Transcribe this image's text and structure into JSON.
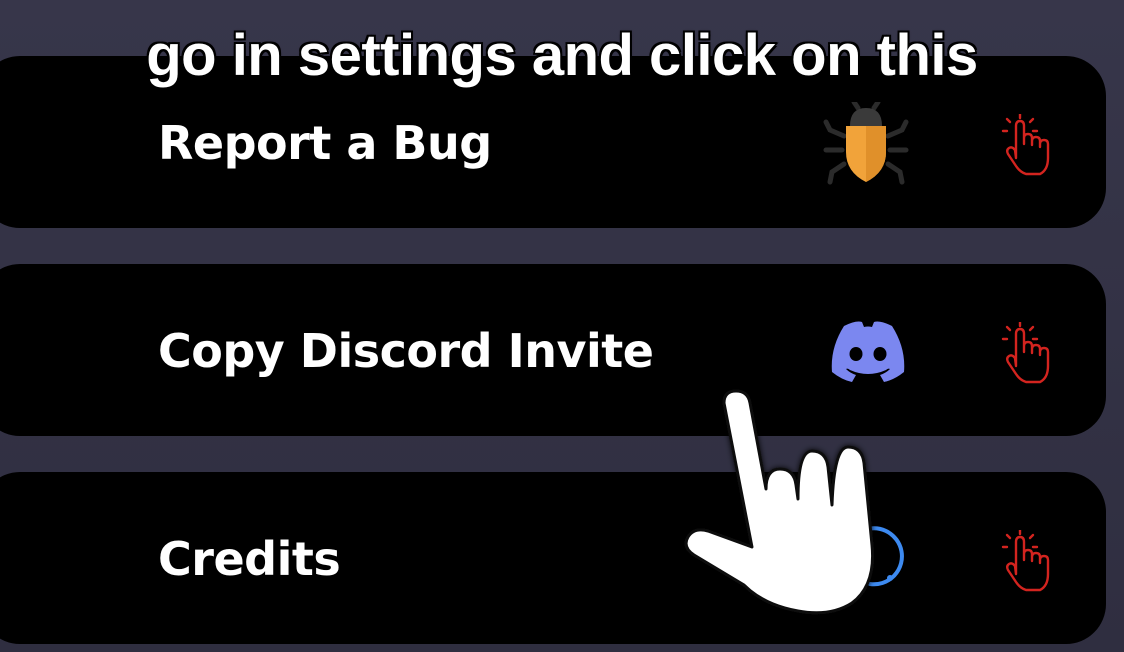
{
  "caption": "go in settings and click on this",
  "settings": {
    "items": [
      {
        "label": "Report a Bug",
        "icon": "bug-icon"
      },
      {
        "label": "Copy Discord Invite",
        "icon": "discord-icon"
      },
      {
        "label": "Credits",
        "icon": "credits-icon"
      }
    ],
    "tap_icon": "tap-hand-icon"
  },
  "colors": {
    "background": "#35344a",
    "card": "#000000",
    "text": "#ffffff",
    "bug_orange": "#f1a33a",
    "discord_blurple": "#7b87f0",
    "credits_blue": "#3d8af0",
    "tap_red": "#d3241f"
  }
}
